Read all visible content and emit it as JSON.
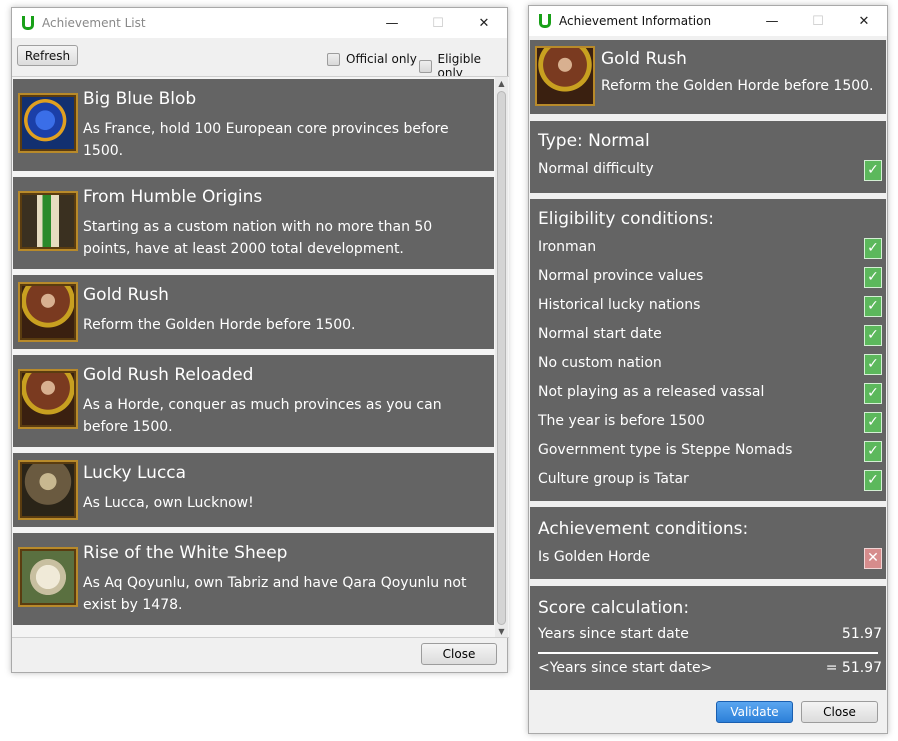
{
  "list_window": {
    "title": "Achievement List",
    "refresh_label": "Refresh",
    "official_only_label": "Official only",
    "eligible_only_label": "Eligible only",
    "close_label": "Close",
    "items": [
      {
        "name": "Big Blue Blob",
        "description": "As France, hold 100 European core provinces before 1500.",
        "icon": "blue-blob-icon"
      },
      {
        "name": "From Humble Origins",
        "description": "Starting as a custom nation with no more than 50 points, have at least 2000 total development.",
        "icon": "chess-pieces-icon"
      },
      {
        "name": "Gold Rush",
        "description": "Reform the Golden Horde before 1500.",
        "icon": "gold-rush-icon"
      },
      {
        "name": "Gold Rush Reloaded",
        "description": "As a Horde, conquer as much provinces as you can before 1500.",
        "icon": "gold-rush-icon"
      },
      {
        "name": "Lucky Lucca",
        "description": "As Lucca, own Lucknow!",
        "icon": "lucky-lucca-icon"
      },
      {
        "name": "Rise of the White Sheep",
        "description": "As Aq Qoyunlu, own Tabriz and have Qara Qoyunlu not exist by 1478.",
        "icon": "white-sheep-icon"
      }
    ]
  },
  "info_window": {
    "title": "Achievement Information",
    "name": "Gold Rush",
    "description": "Reform the Golden Horde before 1500.",
    "type_heading": "Type: Normal",
    "difficulty": "Normal difficulty",
    "eligibility_heading": "Eligibility conditions:",
    "eligibility": [
      "Ironman",
      "Normal province values",
      "Historical lucky nations",
      "Normal start date",
      "No custom nation",
      "Not playing as a released vassal",
      "The year is before 1500",
      "Government type is Steppe Nomads",
      "Culture group is Tatar"
    ],
    "achievement_heading": "Achievement conditions:",
    "achievement_conditions": [
      "Is Golden Horde"
    ],
    "score_heading": "Score calculation:",
    "score_row_label": "Years since start date",
    "score_row_value": "51.97",
    "score_total_label": "<Years since start date>",
    "score_total_value": "= 51.97",
    "check_mark": "✓",
    "cross_mark": "✕",
    "validate_label": "Validate",
    "close_label": "Close"
  },
  "colors": {
    "panel": "#646464",
    "check_green": "#5cb85c",
    "cross_red": "#d68c8c",
    "validate_blue": "#3c8fe6",
    "app_icon_green": "#18a018"
  }
}
